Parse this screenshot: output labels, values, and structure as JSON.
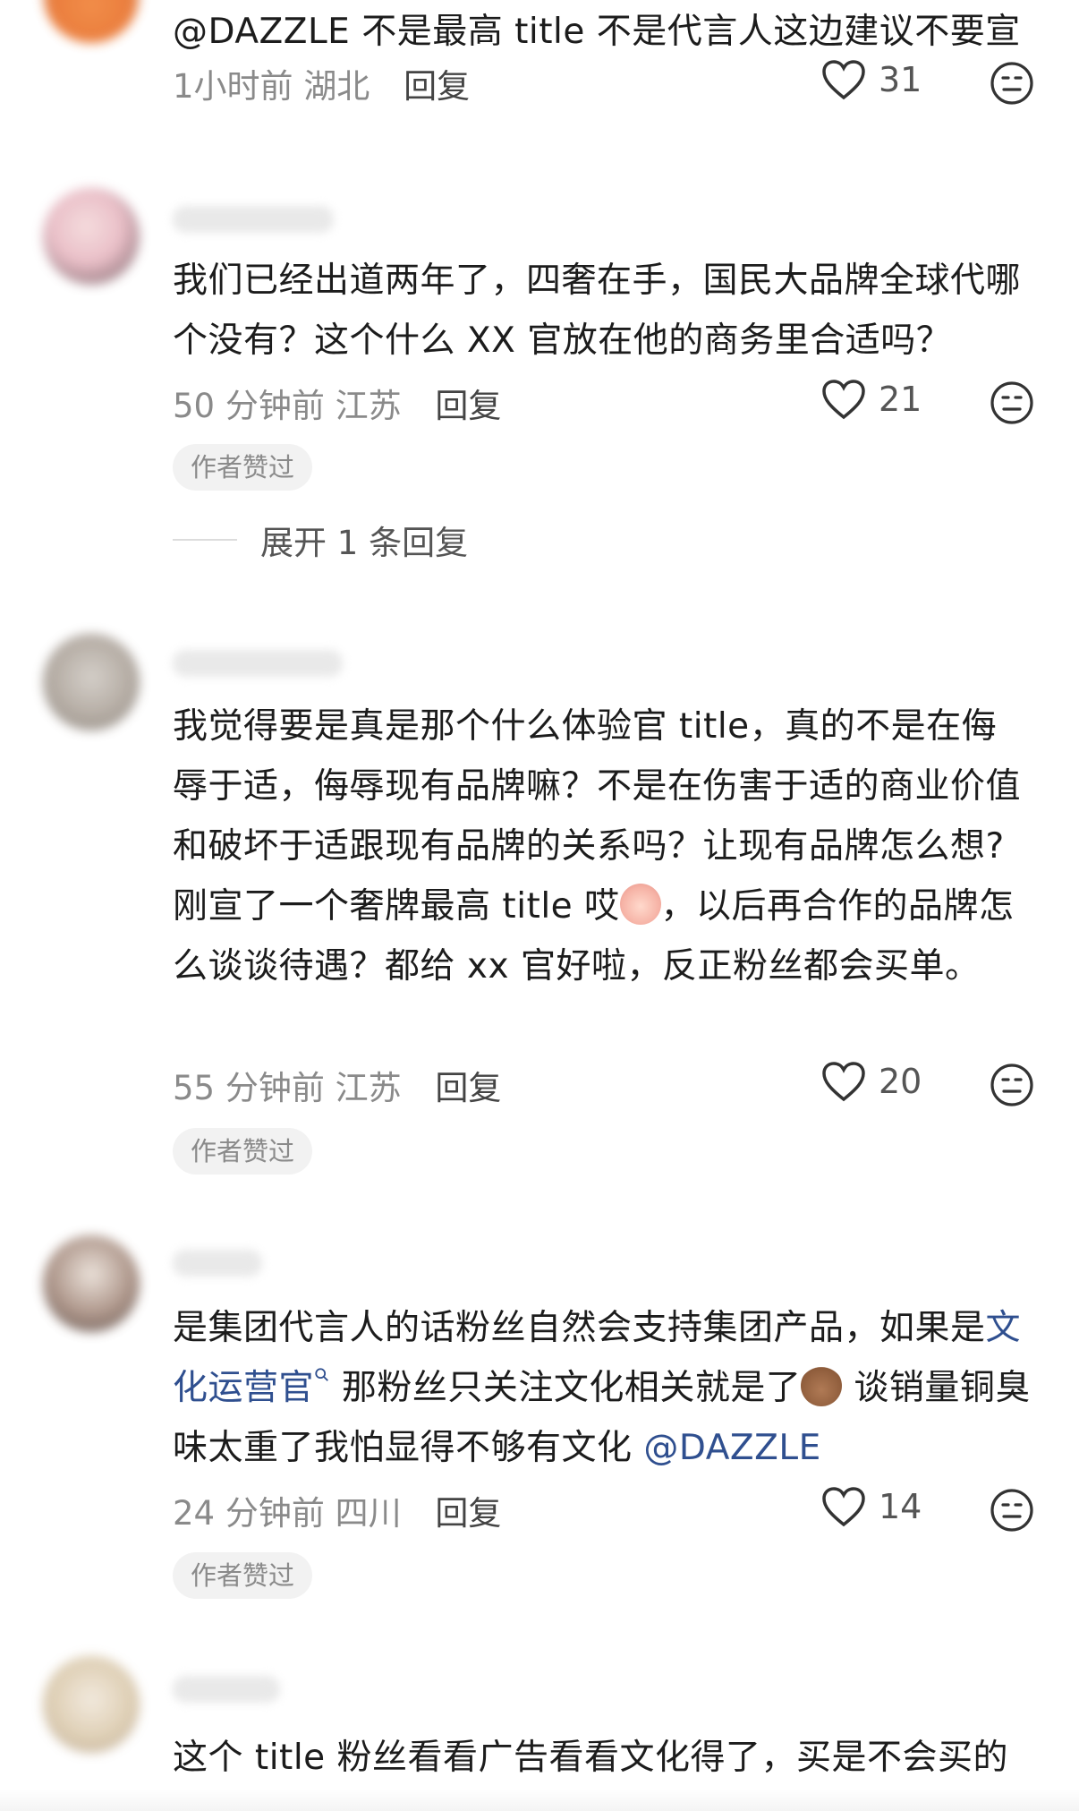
{
  "comments": [
    {
      "text": "@DAZZLE 不是最高 title 不是代言人这边建议不要宣",
      "time": "1小时前",
      "location": "湖北",
      "reply_label": "回复",
      "likes": "31"
    },
    {
      "text": "我们已经出道两年了，四奢在手，国民大品牌全球代哪个没有？这个什么 XX 官放在他的商务里合适吗？",
      "time": "50 分钟前",
      "location": "江苏",
      "reply_label": "回复",
      "likes": "21",
      "badge": "作者赞过",
      "expand": "展开 1 条回复"
    },
    {
      "text_a": "我觉得要是真是那个什么体验官 title，真的不是在侮辱于适，侮辱现有品牌嘛？不是在伤害于适的商业价值和破坏于适跟现有品牌的关系吗？让现有品牌怎么想?刚宣了一个奢牌最高 title 哎",
      "text_b": "，以后再合作的品牌怎么谈谈待遇？都给 xx 官好啦，反正粉丝都会买单。",
      "time": "55 分钟前",
      "location": "江苏",
      "reply_label": "回复",
      "likes": "20",
      "badge": "作者赞过"
    },
    {
      "text_a": "是集团代言人的话粉丝自然会支持集团产品，如果是",
      "link": "文化运营官",
      "text_b": " 那粉丝只关注文化相关就是了",
      "text_c": " 谈销量铜臭味太重了我怕显得不够有文化 ",
      "mention": "@DAZZLE",
      "time": "24 分钟前",
      "location": "四川",
      "reply_label": "回复",
      "likes": "14",
      "badge": "作者赞过"
    },
    {
      "text": "这个 title 粉丝看看广告看看文化得了，买是不会买的"
    }
  ],
  "colors": {
    "accent_link": "#2f4f8f",
    "meta_gray": "#8a8a8a"
  },
  "icons": [
    "heart-outline-icon",
    "meh-face-icon",
    "search-icon",
    "crossed-fingers-emoji",
    "baby-face-emoji"
  ]
}
